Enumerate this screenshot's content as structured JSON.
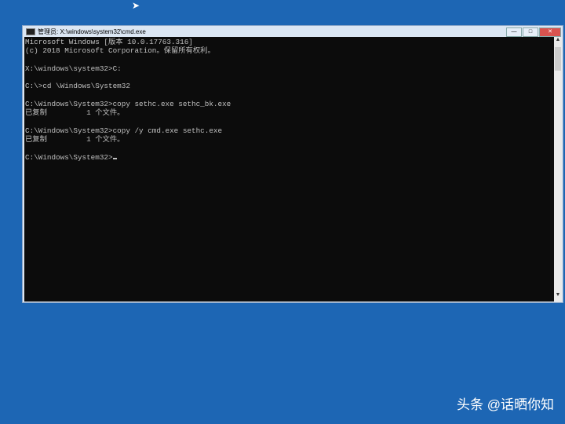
{
  "window": {
    "title": "管理员: X:\\windows\\system32\\cmd.exe",
    "minimize": "—",
    "maximize": "□",
    "close": "✕"
  },
  "console": {
    "lines": [
      "Microsoft Windows [版本 10.0.17763.316]",
      "(c) 2018 Microsoft Corporation。保留所有权利。",
      "",
      "X:\\windows\\system32>C:",
      "",
      "C:\\>cd \\Windows\\System32",
      "",
      "C:\\Windows\\System32>copy sethc.exe sethc_bk.exe",
      "已复制         1 个文件。",
      "",
      "C:\\Windows\\System32>copy /y cmd.exe sethc.exe",
      "已复制         1 个文件。",
      "",
      "C:\\Windows\\System32>"
    ]
  },
  "scroll": {
    "up": "▲",
    "down": "▼"
  },
  "watermark": "头条 @话晒你知"
}
